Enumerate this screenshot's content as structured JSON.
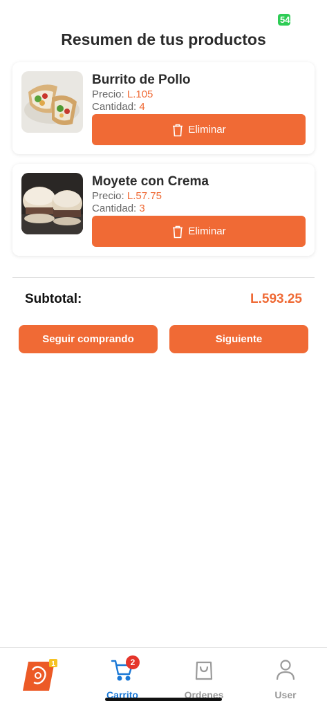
{
  "status": {
    "battery": "54"
  },
  "page_title": "Resumen de tus productos",
  "products": [
    {
      "name": "Burrito de Pollo",
      "price_label": "Precio: ",
      "price": "L.105",
      "qty_label": "Cantidad: ",
      "qty": "4",
      "delete_label": "Eliminar"
    },
    {
      "name": "Moyete con Crema",
      "price_label": "Precio: ",
      "price": "L.57.75",
      "qty_label": "Cantidad: ",
      "qty": "3",
      "delete_label": "Eliminar"
    }
  ],
  "summary": {
    "subtotal_label": "Subtotal:",
    "subtotal_value": "L.593.25"
  },
  "actions": {
    "continue_label": "Seguir comprando",
    "next_label": "Siguiente"
  },
  "tabbar": {
    "cart_label": "Carrito",
    "cart_badge": "2",
    "orders_label": "Ordenes",
    "user_label": "User",
    "logo_badge": "1"
  },
  "colors": {
    "accent": "#f06a35",
    "active_tab": "#1a78d6",
    "badge": "#e5352b"
  }
}
